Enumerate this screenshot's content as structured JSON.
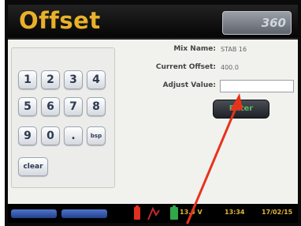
{
  "header": {
    "title": "Offset",
    "logo_text": "360"
  },
  "info": {
    "mix_name_label": "Mix Name:",
    "mix_name_value": "STAB 16",
    "current_offset_label": "Current Offset:",
    "current_offset_value": "400.0",
    "adjust_value_label": "Adjust Value:",
    "adjust_value_input": ""
  },
  "keypad": {
    "keys": [
      "1",
      "2",
      "3",
      "4",
      "5",
      "6",
      "7",
      "8",
      "9",
      "0",
      ".",
      "bsp"
    ],
    "clear_label": "clear"
  },
  "enter_button": {
    "label": "Enter"
  },
  "footer": {
    "voltage": "13.3 V",
    "time": "13:34",
    "date": "17/02/15"
  },
  "colors": {
    "title": "#e9b12a",
    "annotation_arrow": "#e8321c",
    "footer_text": "#e2b43a"
  }
}
